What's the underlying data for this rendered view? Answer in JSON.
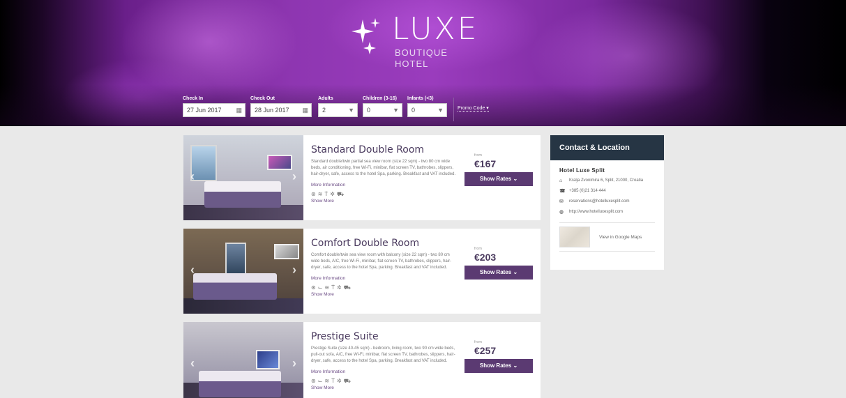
{
  "brand": {
    "title": "LUXE",
    "subtitle_line1": "BOUTIQUE",
    "subtitle_line2": "HOTEL"
  },
  "booking": {
    "checkin_label": "Check In",
    "checkin_value": "27 Jun 2017",
    "checkout_label": "Check Out",
    "checkout_value": "28 Jun 2017",
    "adults_label": "Adults",
    "adults_value": "2",
    "children_label": "Children (3-16)",
    "children_value": "0",
    "infants_label": "Infants (<3)",
    "infants_value": "0",
    "promo_label": "Promo Code"
  },
  "rooms": [
    {
      "title": "Standard Double Room",
      "desc": "Standard double/twin partial sea view room (size 22 sqm) - two 80 cm wide beds, air conditioning, free Wi-Fi, minibar, flat screen TV, bathrobes, slippers, hair-dryer, safe, access to the hotel Spa, parking. Breakfast and VAT included.",
      "more": "More Information",
      "show_more": "Show More",
      "from": "from",
      "price": "€167",
      "button": "Show Rates"
    },
    {
      "title": "Comfort Double Room",
      "desc": "Comfort double/twin sea view room with balcony (size 22 sqm) - two 80 cm wide beds, A/C, free Wi-Fi, minibar, flat screen TV, bathrobes, slippers, hair-dryer, safe, access to the hotel Spa, parking. Breakfast and VAT included.",
      "more": "More Information",
      "show_more": "Show More",
      "from": "from",
      "price": "€203",
      "button": "Show Rates"
    },
    {
      "title": "Prestige Suite",
      "desc": "Prestige Suite (size 40-45 sqm) - bedroom, living room, two 90 cm wide beds, pull-out sofa, A/C, free Wi-Fi, minibar, flat screen TV, bathrobes, slippers, hair-dryer, safe, access to the hotel Spa, parking. Breakfast and VAT included.",
      "more": "More Information",
      "show_more": "Show More",
      "from": "from",
      "price": "€257",
      "button": "Show Rates"
    }
  ],
  "contact": {
    "heading": "Contact & Location",
    "hotel_name": "Hotel Luxe Split",
    "address": "Kralja Zvonimira 6, Split, 21000, Croatia",
    "phone": "+385 (0)21 314 444",
    "email": "reservations@hotelluxesplit.com",
    "web": "http://www.hotelluxesplit.com",
    "maps": "View in Google Maps"
  },
  "colors": {
    "accent": "#5b3a72",
    "sidebar_header": "#263544",
    "header_purple": "#8e36b1"
  }
}
